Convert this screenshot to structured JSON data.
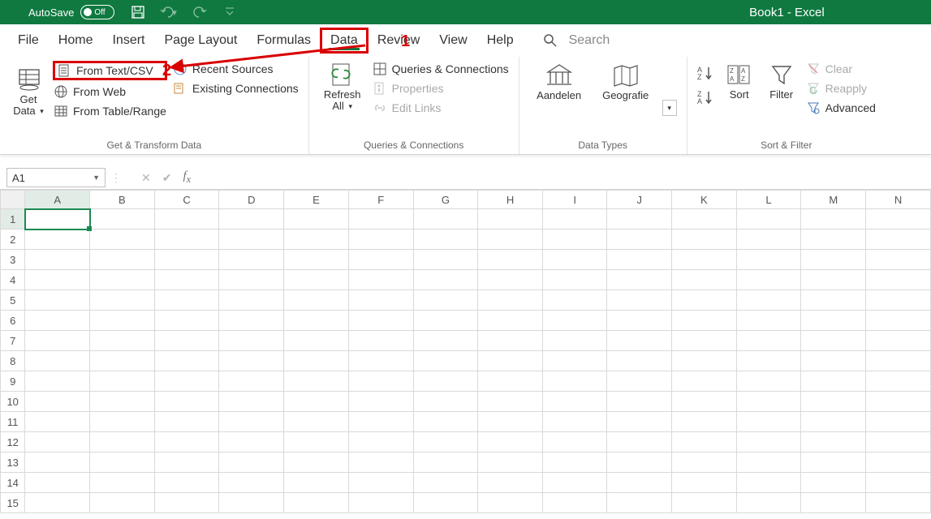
{
  "titlebar": {
    "autosave_label": "AutoSave",
    "autosave_state": "Off",
    "app_title": "Book1  -  Excel"
  },
  "menu": {
    "file": "File",
    "home": "Home",
    "insert": "Insert",
    "pagelayout": "Page Layout",
    "formulas": "Formulas",
    "data": "Data",
    "review": "Review",
    "view": "View",
    "help": "Help",
    "search": "Search"
  },
  "ribbon": {
    "get_transform": {
      "get_data": "Get Data",
      "from_text_csv": "From Text/CSV",
      "from_web": "From Web",
      "from_table_range": "From Table/Range",
      "recent_sources": "Recent Sources",
      "existing_connections": "Existing Connections",
      "group_label": "Get & Transform Data"
    },
    "queries": {
      "refresh_all": "Refresh All",
      "queries_connections": "Queries & Connections",
      "properties": "Properties",
      "edit_links": "Edit Links",
      "group_label": "Queries & Connections"
    },
    "data_types": {
      "aandelen": "Aandelen",
      "geografie": "Geografie",
      "group_label": "Data Types"
    },
    "sort_filter": {
      "sort": "Sort",
      "filter": "Filter",
      "clear": "Clear",
      "reapply": "Reapply",
      "advanced": "Advanced",
      "group_label": "Sort & Filter"
    }
  },
  "annotations": {
    "one": "1",
    "two": "2"
  },
  "formula": {
    "cell_ref": "A1",
    "value": ""
  },
  "grid": {
    "cols": [
      "A",
      "B",
      "C",
      "D",
      "E",
      "F",
      "G",
      "H",
      "I",
      "J",
      "K",
      "L",
      "M",
      "N"
    ],
    "rows": [
      1,
      2,
      3,
      4,
      5,
      6,
      7,
      8,
      9,
      10,
      11,
      12,
      13,
      14,
      15
    ]
  }
}
